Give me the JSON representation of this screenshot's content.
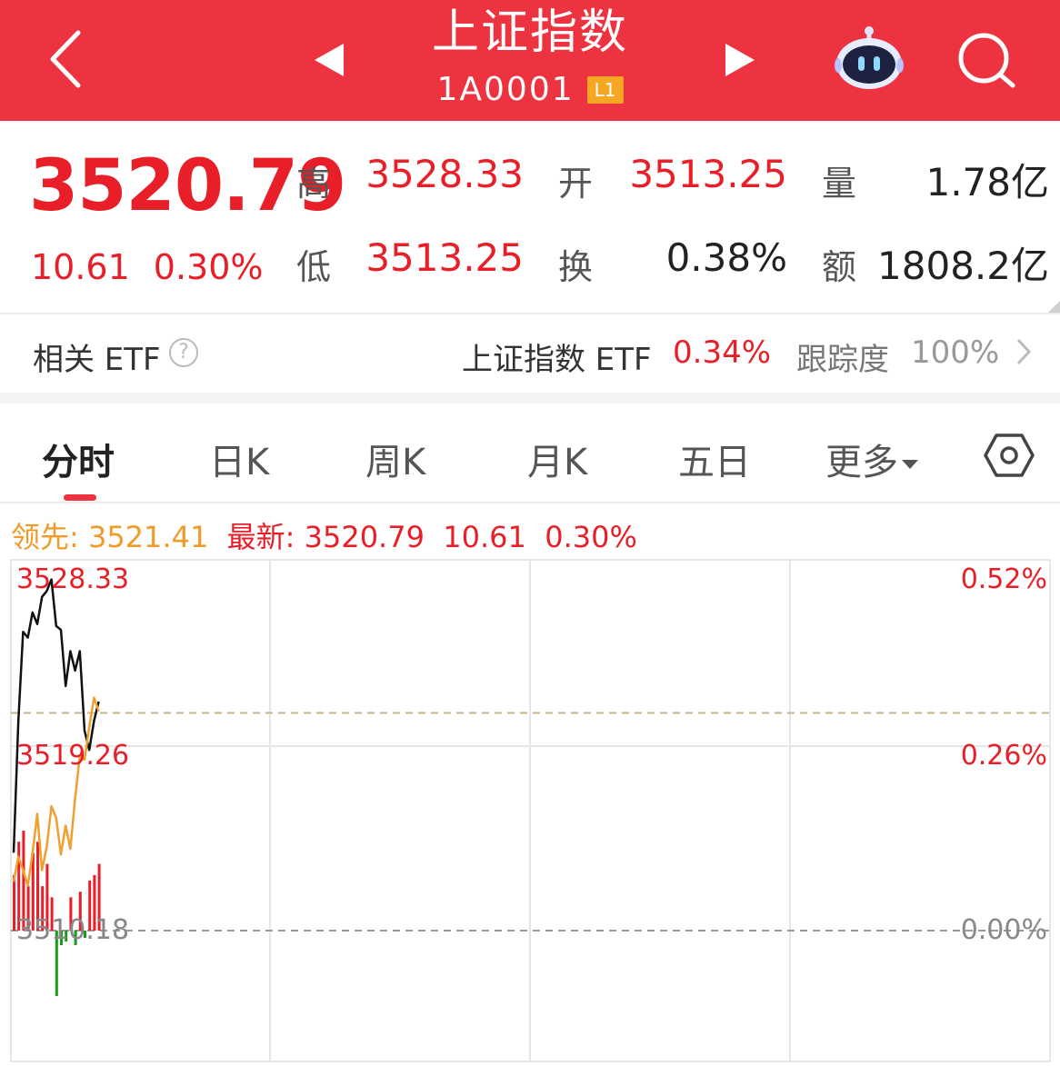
{
  "header": {
    "title": "上证指数",
    "code": "1A0001",
    "level_badge": "L1",
    "icons": [
      "back-arrow-icon",
      "prev-triangle-icon",
      "next-triangle-icon",
      "robot-assistant-icon",
      "search-icon"
    ],
    "bg_color": "#ee3340"
  },
  "quote": {
    "price": "3520.79",
    "change": "10.61",
    "change_pct": "0.30%",
    "high_label": "高",
    "high": "3528.33",
    "open_label": "开",
    "open": "3513.25",
    "volume_label": "量",
    "volume": "1.78亿",
    "low_label": "低",
    "low": "3513.25",
    "turnover_label": "换",
    "turnover": "0.38%",
    "amount_label": "额",
    "amount": "1808.2亿"
  },
  "etf": {
    "label": "相关 ETF",
    "help_glyph": "?",
    "name": "上证指数 ETF",
    "pct": "0.34%",
    "track_label": "跟踪度",
    "track_value": "100%"
  },
  "tabs": {
    "items": [
      "分时",
      "日K",
      "周K",
      "月K",
      "五日",
      "更多"
    ],
    "active": "分时"
  },
  "leader": {
    "lead_label": "领先:",
    "lead_value": "3521.41",
    "latest_label": "最新:",
    "latest_value": "3520.79",
    "latest_change": "10.61",
    "latest_pct": "0.30%"
  },
  "chart_data": {
    "type": "line",
    "y_left_labels": [
      "3528.33",
      "3519.26",
      "3510.18"
    ],
    "y_right_labels": [
      "0.52%",
      "0.26%",
      "0.00%"
    ],
    "ylim": [
      3510.18,
      3528.33
    ],
    "prev_close": 3510.18,
    "reference_dashed": 3521.41,
    "series": [
      {
        "color": "#111111",
        "values": [
          3514.2,
          3521.0,
          3525.6,
          3525.3,
          3526.6,
          3526.0,
          3527.4,
          3527.7,
          3528.3,
          3525.9,
          3525.7,
          3522.8,
          3524.6,
          3523.6,
          3524.6,
          3520.5,
          3519.5,
          3521.0,
          3522.0
        ]
      },
      {
        "color": "#f0a030",
        "values": [
          3512.7,
          3514.0,
          3513.3,
          3512.5,
          3514.2,
          3516.2,
          3513.3,
          3514.5,
          3516.6,
          3516.0,
          3514.1,
          3515.6,
          3514.4,
          3517.0,
          3519.2,
          3519.0,
          3520.7,
          3522.2,
          3521.5
        ]
      }
    ],
    "volume": [
      {
        "v": 5,
        "dir": "up"
      },
      {
        "v": 8,
        "dir": "up"
      },
      {
        "v": 9,
        "dir": "up"
      },
      {
        "v": 4,
        "dir": "up"
      },
      {
        "v": 7,
        "dir": "up"
      },
      {
        "v": 8,
        "dir": "up"
      },
      {
        "v": 4,
        "dir": "up"
      },
      {
        "v": 6,
        "dir": "up"
      },
      {
        "v": 3,
        "dir": "up"
      },
      {
        "v": 9,
        "dir": "down"
      },
      {
        "v": 2,
        "dir": "down"
      },
      {
        "v": 1.5,
        "dir": "down"
      },
      {
        "v": 3,
        "dir": "up"
      },
      {
        "v": 2,
        "dir": "down"
      },
      {
        "v": 3.5,
        "dir": "up"
      },
      {
        "v": 1,
        "dir": "down"
      },
      {
        "v": 4.5,
        "dir": "up"
      },
      {
        "v": 5,
        "dir": "up"
      },
      {
        "v": 6,
        "dir": "up"
      }
    ],
    "colors": {
      "up": "#e81f28",
      "down": "#1a9a1a",
      "grid": "#e6e6e6",
      "dashed": "#999999"
    }
  }
}
